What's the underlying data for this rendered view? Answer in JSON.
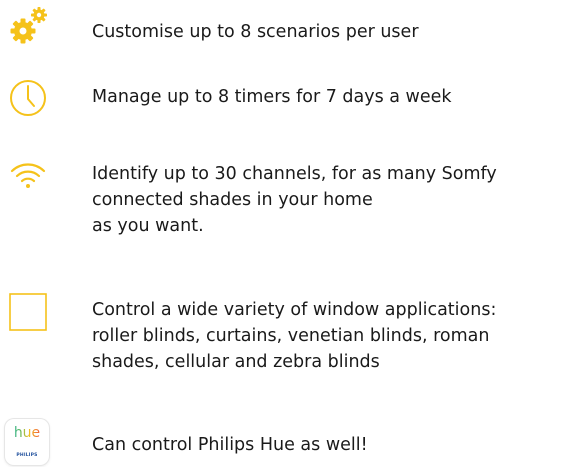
{
  "colors": {
    "accent": "#F5C21A",
    "text": "#1A1A1A"
  },
  "features": [
    {
      "icon": "gears-icon",
      "lines": [
        "Customise up to 8 scenarios per user"
      ]
    },
    {
      "icon": "clock-icon",
      "lines": [
        "Manage up to 8 timers for 7 days a week"
      ]
    },
    {
      "icon": "wifi-icon",
      "lines": [
        "Identify up to 30 channels, for as many Somfy",
        "connected shades in your home",
        "as you want."
      ]
    },
    {
      "icon": "window-icon",
      "lines": [
        "Control a wide variety of window applications:",
        "roller blinds, curtains, venetian blinds, roman",
        "shades, cellular and zebra blinds"
      ]
    },
    {
      "icon": "philips-hue-icon",
      "logo_text": "hue",
      "logo_brand": "PHILIPS",
      "lines": [
        "Can control Philips Hue as well!"
      ]
    }
  ]
}
